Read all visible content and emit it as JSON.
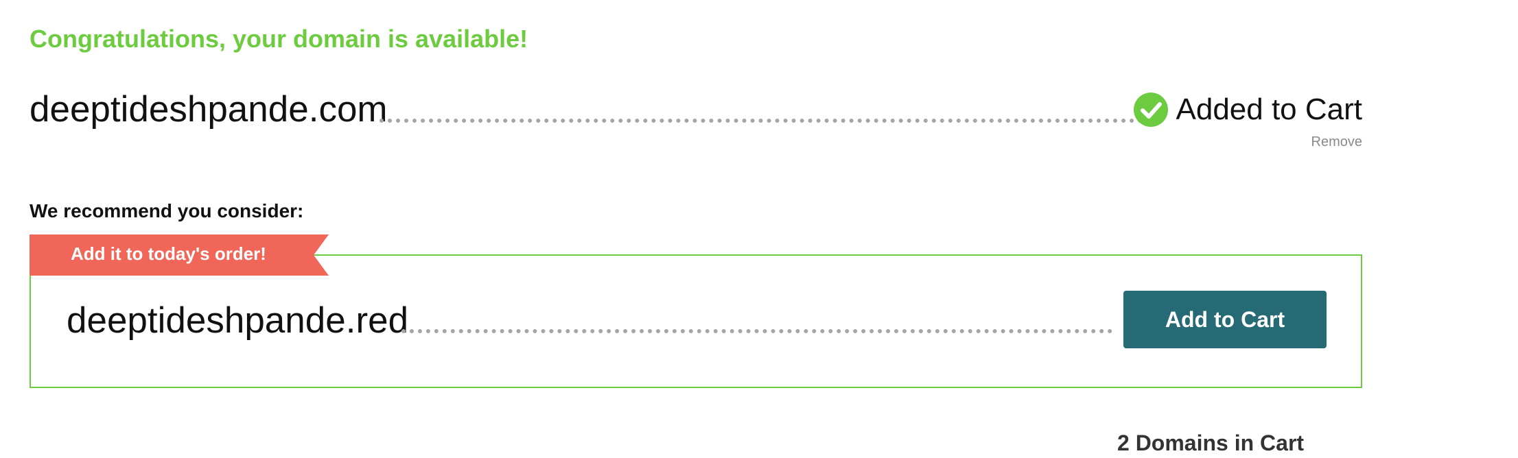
{
  "result": {
    "headline": "Congratulations, your domain is available!",
    "domain": "deeptideshpande.com",
    "status_label": "Added to Cart",
    "remove_label": "Remove"
  },
  "recommendation": {
    "heading": "We recommend you consider:",
    "ribbon_label": "Add it to today's order!",
    "domain": "deeptideshpande.red",
    "button_label": "Add to Cart"
  },
  "cart": {
    "count_label": "2 Domains in Cart"
  },
  "colors": {
    "success_green": "#6ccb3f",
    "ribbon_coral": "#f0675a",
    "button_teal": "#266a76",
    "dot_leader_gray": "#a5a5a5"
  },
  "icons": {
    "added_status": "check-circle-icon"
  }
}
